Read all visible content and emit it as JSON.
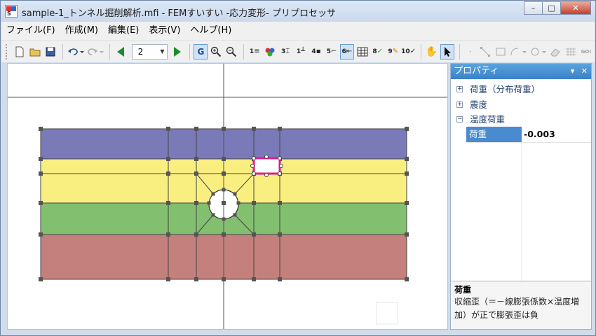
{
  "window": {
    "title": "sample-1_トンネル掘削解析.mfi - FEMすいすい -応力変形- プリプロセッサ",
    "app_icon": "app-logo-icon",
    "buttons": {
      "minimize": "–",
      "maximize": "□",
      "close": "✕"
    }
  },
  "menu": [
    {
      "label": "ファイル(F)"
    },
    {
      "label": "作成(M)"
    },
    {
      "label": "編集(E)"
    },
    {
      "label": "表示(V)"
    },
    {
      "label": "ヘルプ(H)"
    }
  ],
  "toolbar": {
    "icons": [
      "new-file-icon",
      "open-folder-icon",
      "save-icon",
      "undo-icon",
      "redo-icon",
      "prev-page-icon",
      "next-page-icon",
      "grid-icon",
      "zoom-in-icon",
      "zoom-out-icon",
      "hand-pan-icon",
      "select-arrow-icon"
    ],
    "page_value": "2",
    "mini_labels": {
      "b1": "1",
      "b2": "3",
      "b3": "1",
      "b4": "4",
      "b5": "5",
      "b6": "6",
      "b7": "8",
      "b8": "9",
      "b9": "10",
      "b10": "GO!"
    }
  },
  "panel": {
    "title": "プロパティ",
    "pin": "▾",
    "close": "✕",
    "groups": [
      {
        "label": "荷重（分布荷重）",
        "expander": "+"
      },
      {
        "label": "震度",
        "expander": "+"
      },
      {
        "label": "温度荷重",
        "expander": "−"
      }
    ],
    "property": {
      "name": "荷重",
      "value": "-0.003"
    },
    "description": {
      "title": "荷重",
      "line1": "収縮歪（＝－線膨張係数×温度増",
      "line2": "加）が正で膨張歪は負"
    }
  },
  "colors": {
    "layer_top": "#7b7ab8",
    "layer_second": "#f9ee80",
    "layer_third": "#82bf6f",
    "layer_bottom": "#c4807c",
    "selection": "#e01e8c",
    "panel_header": "#3a82c8"
  }
}
